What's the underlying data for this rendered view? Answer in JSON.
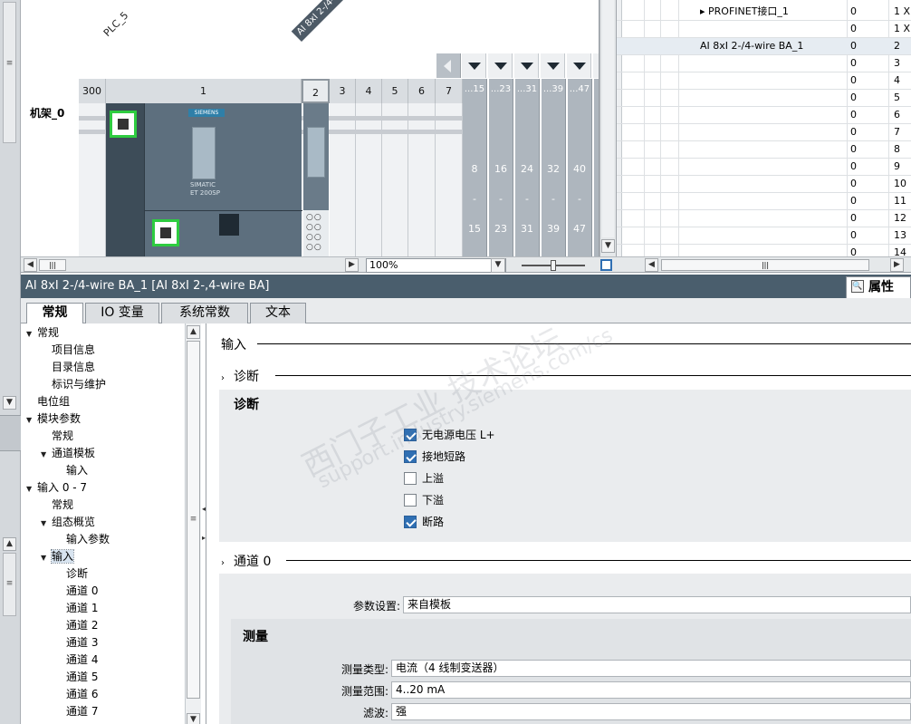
{
  "device_view": {
    "plc_label": "PLC_5",
    "module_label": "AI 8xI 2-/4-w",
    "rack_label": "机架_0",
    "slots": [
      "300",
      "1",
      "2",
      "3",
      "4",
      "5",
      "6",
      "7"
    ],
    "gray_slots": [
      {
        "top": "...15",
        "mid": "8",
        "dash": "-",
        "bot": "15"
      },
      {
        "top": "...23",
        "mid": "16",
        "dash": "-",
        "bot": "23"
      },
      {
        "top": "...31",
        "mid": "24",
        "dash": "-",
        "bot": "31"
      },
      {
        "top": "...39",
        "mid": "32",
        "dash": "-",
        "bot": "39"
      },
      {
        "top": "...47",
        "mid": "40",
        "dash": "-",
        "bot": "47"
      }
    ],
    "cpu_brand": "SIEMENS",
    "cpu_name_line1": "SIMATIC",
    "cpu_name_line2": "ET 200SP",
    "zoom": "100%"
  },
  "device_table": {
    "rows": [
      {
        "name": "▸ PROFINET接口_1",
        "c2": "0",
        "c3": "1 X"
      },
      {
        "name": "",
        "c2": "0",
        "c3": "1 X"
      },
      {
        "name": "AI 8xI 2-/4-wire BA_1",
        "c2": "0",
        "c3": "2"
      },
      {
        "name": "",
        "c2": "0",
        "c3": "3"
      },
      {
        "name": "",
        "c2": "0",
        "c3": "4"
      },
      {
        "name": "",
        "c2": "0",
        "c3": "5"
      },
      {
        "name": "",
        "c2": "0",
        "c3": "6"
      },
      {
        "name": "",
        "c2": "0",
        "c3": "7"
      },
      {
        "name": "",
        "c2": "0",
        "c3": "8"
      },
      {
        "name": "",
        "c2": "0",
        "c3": "9"
      },
      {
        "name": "",
        "c2": "0",
        "c3": "10"
      },
      {
        "name": "",
        "c2": "0",
        "c3": "11"
      },
      {
        "name": "",
        "c2": "0",
        "c3": "12"
      },
      {
        "name": "",
        "c2": "0",
        "c3": "13"
      },
      {
        "name": "",
        "c2": "0",
        "c3": "14"
      }
    ]
  },
  "properties": {
    "title": "AI 8xI 2-/4-wire BA_1 [AI 8xI 2-,4-wire BA]",
    "properties_button": "属性",
    "tabs": [
      "常规",
      "IO 变量",
      "系统常数",
      "文本"
    ]
  },
  "nav": {
    "items": [
      {
        "label": "常规",
        "level": 0,
        "arrow": "▼"
      },
      {
        "label": "项目信息",
        "level": 1,
        "arrow": ""
      },
      {
        "label": "目录信息",
        "level": 1,
        "arrow": ""
      },
      {
        "label": "标识与维护",
        "level": 1,
        "arrow": ""
      },
      {
        "label": "电位组",
        "level": 0,
        "arrow": ""
      },
      {
        "label": "模块参数",
        "level": 0,
        "arrow": "▼"
      },
      {
        "label": "常规",
        "level": 1,
        "arrow": ""
      },
      {
        "label": "通道模板",
        "level": 1,
        "arrow": "▼"
      },
      {
        "label": "输入",
        "level": 2,
        "arrow": ""
      },
      {
        "label": "输入 0 - 7",
        "level": 0,
        "arrow": "▼"
      },
      {
        "label": "常规",
        "level": 1,
        "arrow": ""
      },
      {
        "label": "组态概览",
        "level": 1,
        "arrow": "▼"
      },
      {
        "label": "输入参数",
        "level": 2,
        "arrow": ""
      },
      {
        "label": "输入",
        "level": 1,
        "arrow": "▼",
        "selected": true
      },
      {
        "label": "诊断",
        "level": 2,
        "arrow": ""
      },
      {
        "label": "通道 0",
        "level": 2,
        "arrow": ""
      },
      {
        "label": "通道 1",
        "level": 2,
        "arrow": ""
      },
      {
        "label": "通道 2",
        "level": 2,
        "arrow": ""
      },
      {
        "label": "通道 3",
        "level": 2,
        "arrow": ""
      },
      {
        "label": "通道 4",
        "level": 2,
        "arrow": ""
      },
      {
        "label": "通道 5",
        "level": 2,
        "arrow": ""
      },
      {
        "label": "通道 6",
        "level": 2,
        "arrow": ""
      },
      {
        "label": "通道 7",
        "level": 2,
        "arrow": ""
      }
    ]
  },
  "pane": {
    "input_heading": "输入",
    "diag_section": "诊断",
    "diag_box_title": "诊断",
    "checkboxes": [
      {
        "label": "无电源电压 L+",
        "checked": true
      },
      {
        "label": "接地短路",
        "checked": true
      },
      {
        "label": "上溢",
        "checked": false
      },
      {
        "label": "下溢",
        "checked": false
      },
      {
        "label": "断路",
        "checked": true
      }
    ],
    "channel_section": "通道 0",
    "param_label": "参数设置:",
    "param_value": "来自模板",
    "measure_title": "测量",
    "fields": [
      {
        "label": "测量类型:",
        "value": "电流（4 线制变送器）"
      },
      {
        "label": "测量范围:",
        "value": "4..20 mA"
      },
      {
        "label": "滤波:",
        "value": "强"
      }
    ]
  },
  "watermark": {
    "line1": "西门子工业  技术论坛",
    "line2": "support.industry.siemens.com/cs"
  }
}
